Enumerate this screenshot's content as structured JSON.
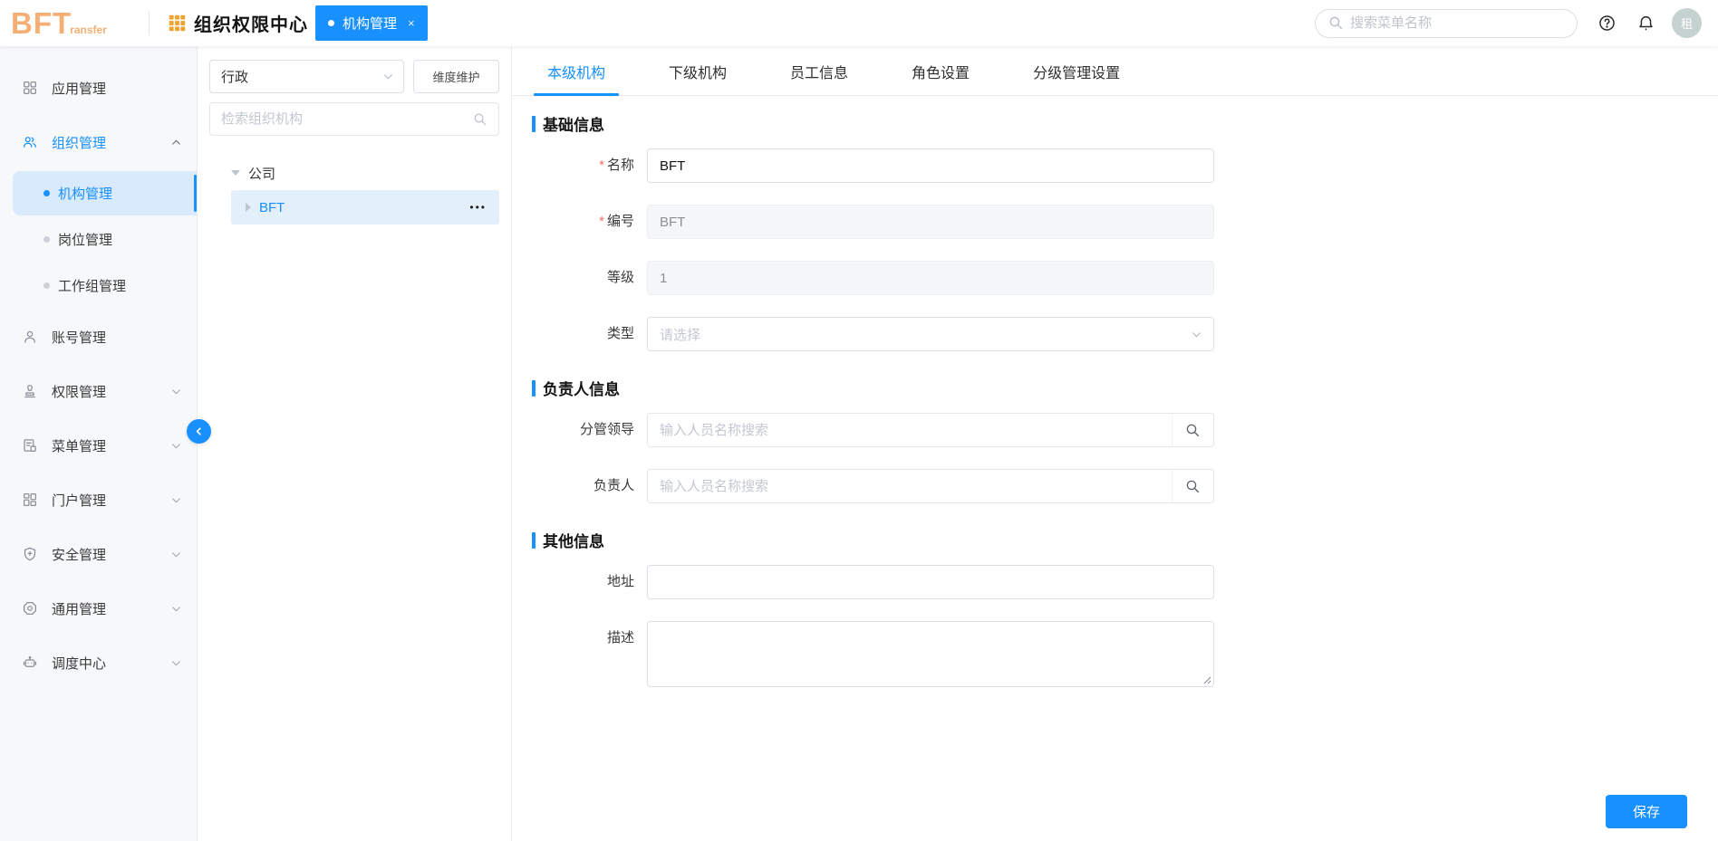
{
  "header": {
    "logo_text": "BFT",
    "logo_sub": "ransfer",
    "app_title": "组织权限中心",
    "tab_label": "机构管理",
    "tab_close": "×",
    "search_placeholder": "搜索菜单名称",
    "avatar_text": "租"
  },
  "sidebar": {
    "items": [
      {
        "label": "应用管理"
      },
      {
        "label": "组织管理"
      },
      {
        "label": "账号管理"
      },
      {
        "label": "权限管理"
      },
      {
        "label": "菜单管理"
      },
      {
        "label": "门户管理"
      },
      {
        "label": "安全管理"
      },
      {
        "label": "通用管理"
      },
      {
        "label": "调度中心"
      }
    ],
    "submenu": [
      {
        "label": "机构管理"
      },
      {
        "label": "岗位管理"
      },
      {
        "label": "工作组管理"
      }
    ]
  },
  "tree": {
    "dimension_value": "行政",
    "dimension_btn": "维度维护",
    "search_placeholder": "检索组织机构",
    "root_label": "公司",
    "node_label": "BFT",
    "more_label": "•••"
  },
  "main": {
    "tabs": [
      {
        "label": "本级机构"
      },
      {
        "label": "下级机构"
      },
      {
        "label": "员工信息"
      },
      {
        "label": "角色设置"
      },
      {
        "label": "分级管理设置"
      }
    ],
    "required_mark": "*",
    "sections": [
      {
        "title": "基础信息",
        "fields": [
          {
            "label": "名称",
            "value": "BFT"
          },
          {
            "label": "编号",
            "value": "BFT"
          },
          {
            "label": "等级",
            "value": "1"
          },
          {
            "label": "类型",
            "placeholder": "请选择"
          }
        ]
      },
      {
        "title": "负责人信息",
        "fields": [
          {
            "label": "分管领导",
            "placeholder": "输入人员名称搜索"
          },
          {
            "label": "负责人",
            "placeholder": "输入人员名称搜索"
          }
        ]
      },
      {
        "title": "其他信息",
        "fields": [
          {
            "label": "地址",
            "value": ""
          },
          {
            "label": "描述",
            "value": ""
          }
        ]
      }
    ],
    "save_label": "保存"
  },
  "colors": {
    "primary": "#1890ff",
    "logo_orange": "#f5ae73",
    "grid_icon_orange": "#f0a32f",
    "avatar_bg": "#c6d2d0",
    "required_red": "#f56c6c"
  }
}
